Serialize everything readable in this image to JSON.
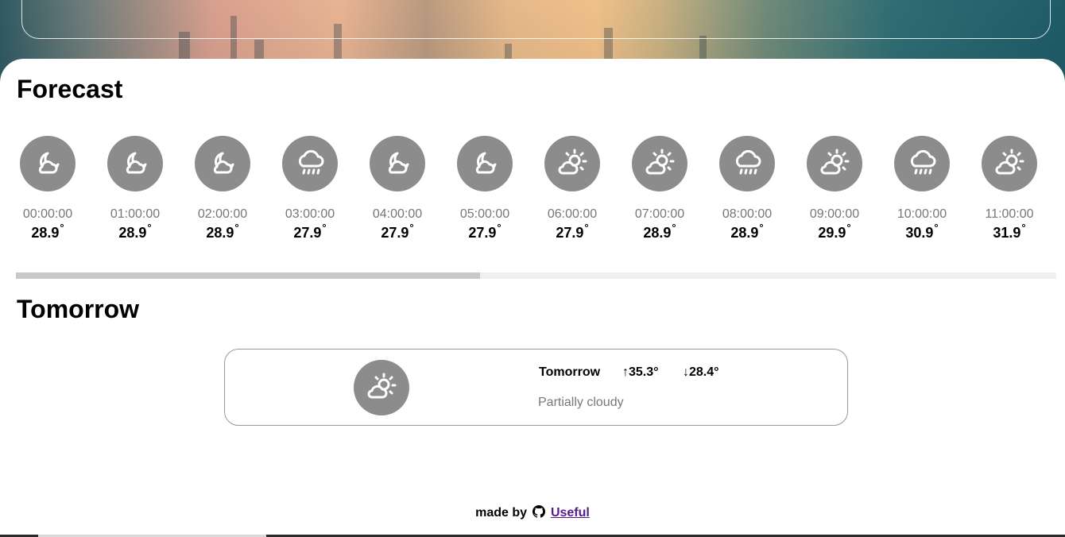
{
  "forecast": {
    "title": "Forecast",
    "hours": [
      {
        "time": "00:00:00",
        "temp": "28.9",
        "icon": "moon-cloud-icon"
      },
      {
        "time": "01:00:00",
        "temp": "28.9",
        "icon": "moon-cloud-icon"
      },
      {
        "time": "02:00:00",
        "temp": "28.9",
        "icon": "moon-cloud-icon"
      },
      {
        "time": "03:00:00",
        "temp": "27.9",
        "icon": "rain-cloud-icon"
      },
      {
        "time": "04:00:00",
        "temp": "27.9",
        "icon": "moon-cloud-icon"
      },
      {
        "time": "05:00:00",
        "temp": "27.9",
        "icon": "moon-cloud-icon"
      },
      {
        "time": "06:00:00",
        "temp": "27.9",
        "icon": "sun-cloud-icon"
      },
      {
        "time": "07:00:00",
        "temp": "28.9",
        "icon": "sun-cloud-icon"
      },
      {
        "time": "08:00:00",
        "temp": "28.9",
        "icon": "rain-cloud-icon"
      },
      {
        "time": "09:00:00",
        "temp": "29.9",
        "icon": "sun-cloud-icon"
      },
      {
        "time": "10:00:00",
        "temp": "30.9",
        "icon": "rain-cloud-icon"
      },
      {
        "time": "11:00:00",
        "temp": "31.9",
        "icon": "sun-cloud-icon"
      }
    ],
    "degree_symbol": "°",
    "scroll_position": 0.446
  },
  "tomorrow": {
    "title": "Tomorrow",
    "day_label": "Tomorrow",
    "high": "↑35.3°",
    "low": "↓28.4°",
    "description": "Partially cloudy",
    "icon": "sun-cloud-icon"
  },
  "footer": {
    "made_by": "made by",
    "link_text": "Useful",
    "icon": "github-icon"
  },
  "colors": {
    "icon_circle": "#8c8c8c",
    "muted_text": "#777777",
    "link": "#551a8b"
  }
}
